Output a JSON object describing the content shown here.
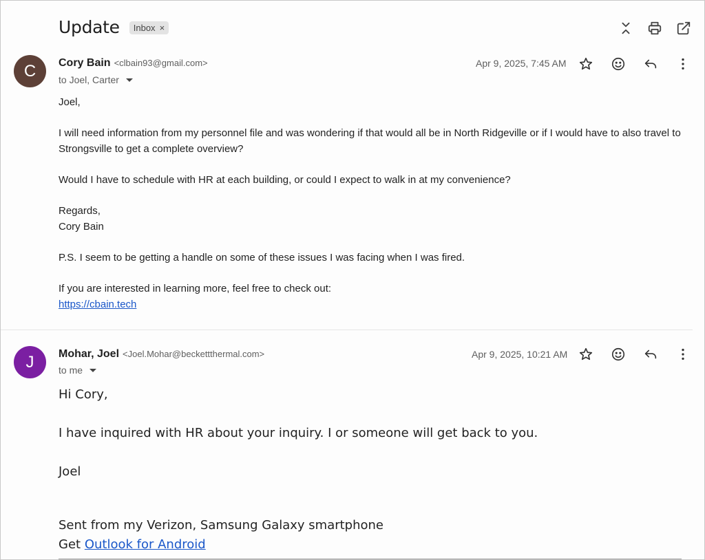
{
  "thread": {
    "subject": "Update",
    "label": "Inbox"
  },
  "toolbar": {
    "icons": [
      "collapse-all-icon",
      "print-icon",
      "open-in-new-window-icon"
    ]
  },
  "messages": [
    {
      "avatar_letter": "C",
      "avatar_color": "#5d4037",
      "sender_name": "Cory Bain",
      "sender_email": "<clbain93@gmail.com>",
      "recipients": "to Joel, Carter",
      "date": "Apr 9, 2025, 7:45 AM",
      "body": [
        "Joel,",
        "I will need information from my personnel file and was wondering if that would all be in North Ridgeville or if I would have to also travel to Strongsville to get a complete overview?",
        "Would I have to schedule with HR at each building, or could I expect to walk in at my convenience?",
        "Regards,",
        "Cory Bain",
        "P.S. I seem to be getting a handle on some of these issues I was facing when I was fired.",
        "If you are interested in learning more, feel free to check out:"
      ],
      "link": "https://cbain.tech"
    },
    {
      "avatar_letter": "J",
      "avatar_color": "#7b1fa2",
      "sender_name": "Mohar, Joel",
      "sender_email": "<Joel.Mohar@beckettthermal.com>",
      "recipients": "to me",
      "date": "Apr 9, 2025, 10:21 AM",
      "body": [
        "Hi Cory,",
        "I have inquired with HR about your inquiry. I or someone will get back to you.",
        "Joel",
        "Sent from my Verizon, Samsung Galaxy smartphone"
      ],
      "signature_prefix": "Get",
      "signature_link": "Outlook for Android"
    }
  ],
  "message_actions": [
    "star-icon",
    "emoji-reaction-icon",
    "reply-icon",
    "more-options-icon"
  ],
  "colors": {
    "link": "#1a57c9",
    "muted_text": "#5e5e5e"
  }
}
